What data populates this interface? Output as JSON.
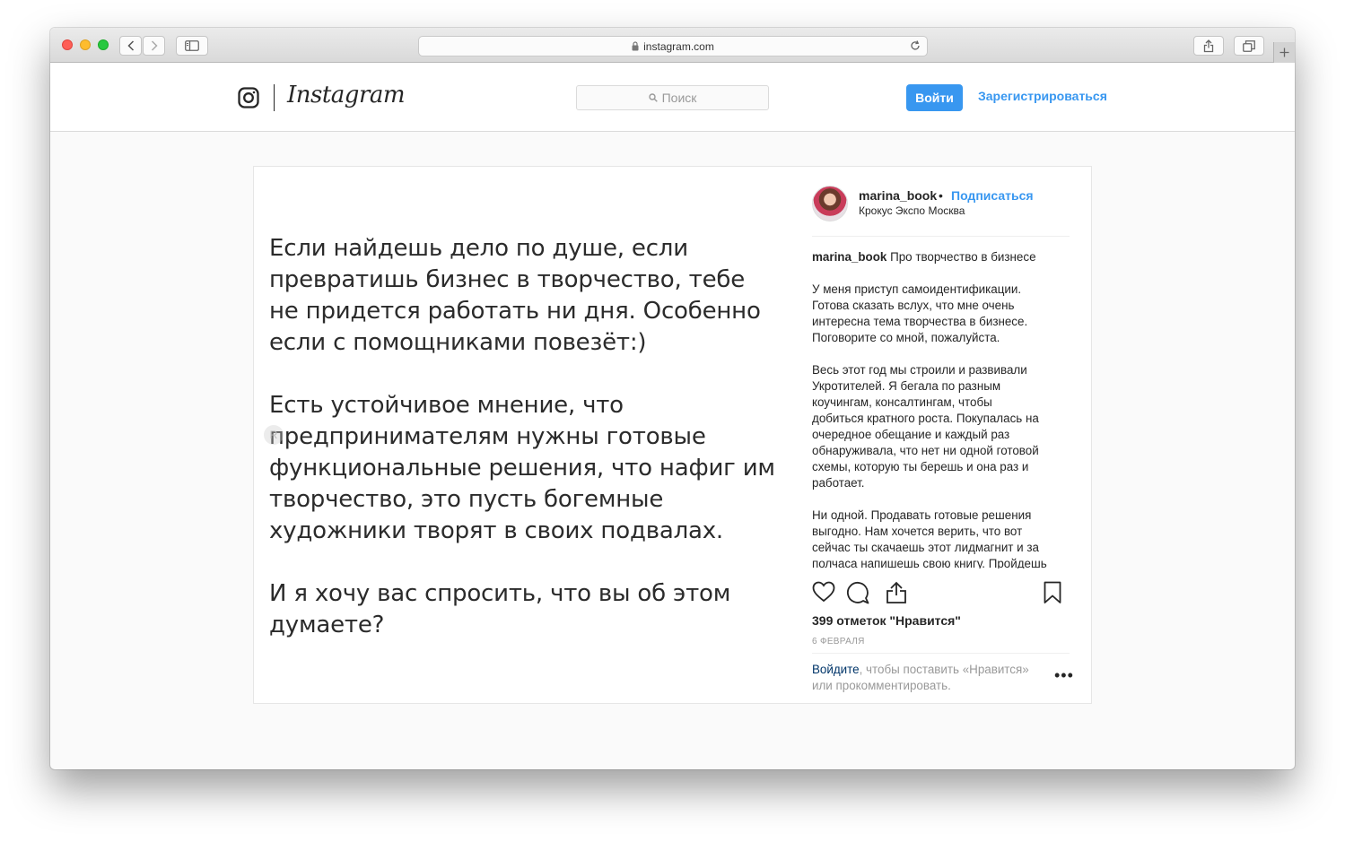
{
  "browser": {
    "url": "instagram.com"
  },
  "header": {
    "logo_text": "Instagram",
    "search_placeholder": "Поиск",
    "login_label": "Войти",
    "signup_label": "Зарегистрироваться",
    "accent_color": "#3897f0"
  },
  "post": {
    "image_paragraphs": [
      "Если найдешь дело по душе, если превратишь бизнес в творчество, тебе не придется работать ни дня. Особенно если с помощниками повезёт:)",
      "Есть устойчивое мнение, что предпринимателям нужны готовые функциональные решения, что нафиг им творчество, это пусть богемные художники творят в своих подвалах.",
      "И я хочу вас спросить, что вы об этом думаете?"
    ],
    "username": "marina_book",
    "dot": "•",
    "follow_label": "Подписаться",
    "location": "Крокус Экспо Москва",
    "caption_username": "marina_book",
    "caption_title": "Про творчество в бизнесе",
    "caption_paragraphs": [
      "У меня приступ самоидентификации.\nГотова сказать вслух, что мне очень\nинтересна тема творчества в бизнесе.\nПоговорите со мной, пожалуйста.",
      "Весь этот год мы строили и развивали\nУкротителей. Я бегала по разным\nкоучингам, консалтингам, чтобы\nдобиться кратного роста. Покупалась на\nочередное обещание и каждый раз\nобнаруживала, что нет ни одной готовой\nсхемы, которую ты берешь и она раз и\nработает.",
      "Ни одной. Продавать готовые решения\nвыгодно. Нам хочется верить, что вот\nсейчас ты скачаешь этот лидмагнит и за\nполчаса напишешь свою книгу. Пройдешь"
    ],
    "likes_text": "399 отметок \"Нравится\"",
    "date": "6 ФЕВРАЛЯ",
    "login_link": "Войдите",
    "login_prompt_rest": ", чтобы поставить «Нравится» или прокомментировать.",
    "more_label": "•••"
  }
}
